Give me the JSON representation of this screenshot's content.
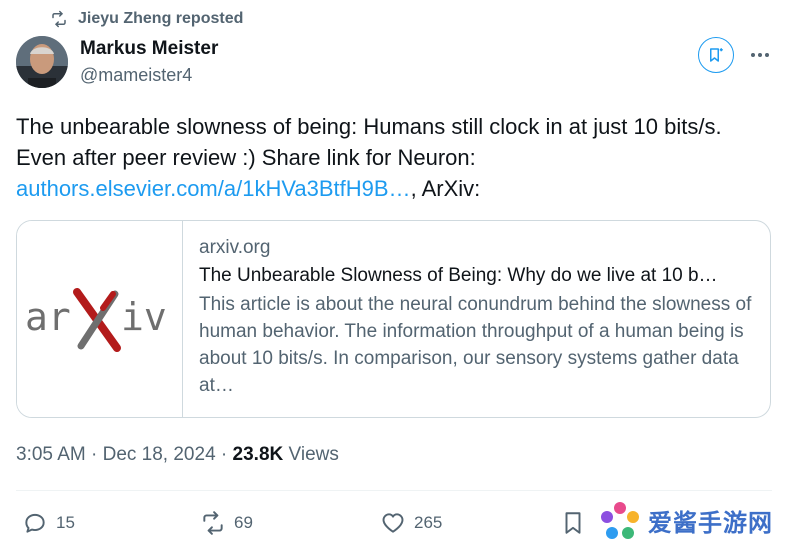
{
  "repost": {
    "label": "Jieyu Zheng reposted"
  },
  "author": {
    "name": "Markus Meister",
    "handle": "@mameister4"
  },
  "tweet": {
    "line1": "The unbearable slowness of being: Humans still clock in at just 10 bits/s.",
    "line2": "Even after peer review :) Share link for Neuron:",
    "link": "authors.elsevier.com/a/1kHVa3BtfH9B…",
    "line3_suffix": ", ArXiv:"
  },
  "card": {
    "thumb_logo": "arXiv",
    "domain": "arxiv.org",
    "title": "The Unbearable Slowness of Being: Why do we live at 10 b…",
    "description": "This article is about the neural conundrum behind the slowness of human behavior. The information throughput of a human being is about 10 bits/s. In comparison, our sensory systems gather data at…"
  },
  "meta": {
    "time": "3:05 AM",
    "separator": " · ",
    "date": "Dec 18, 2024",
    "views_count": "23.8K",
    "views_label": " Views"
  },
  "actions": {
    "replies": "15",
    "reposts": "69",
    "likes": "265"
  },
  "watermark": {
    "text": "爱酱手游网"
  },
  "colors": {
    "accent": "#1d9bf0",
    "muted": "#536471",
    "text": "#0f1419",
    "arxiv_red": "#b31b1b",
    "arxiv_gray": "#6f6f6f"
  }
}
